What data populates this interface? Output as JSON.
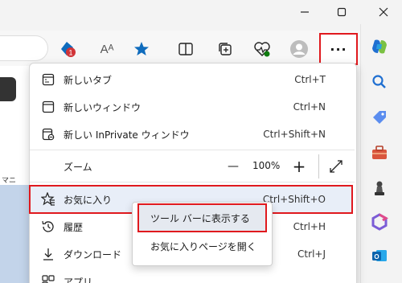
{
  "window": {
    "minimize_icon": "minimize-icon",
    "maximize_icon": "maximize-icon",
    "close_icon": "close-icon"
  },
  "toolbar": {
    "icons": [
      "extension-badge-icon",
      "read-aloud-icon",
      "favorite-star-icon",
      "split-screen-icon",
      "collections-icon",
      "browser-essentials-icon",
      "profile-avatar-icon"
    ],
    "badge_count": "1",
    "read_aloud_glyph": "Aᴬ",
    "more_label": "···"
  },
  "page_bg": {
    "fragment": "マニ"
  },
  "menu": {
    "items": [
      {
        "label": "新しいタブ",
        "shortcut": "Ctrl+T",
        "icon": "new-tab-icon"
      },
      {
        "label": "新しいウィンドウ",
        "shortcut": "Ctrl+N",
        "icon": "new-window-icon"
      },
      {
        "label": "新しい InPrivate ウィンドウ",
        "shortcut": "Ctrl+Shift+N",
        "icon": "inprivate-icon"
      }
    ],
    "zoom": {
      "label": "ズーム",
      "value": "100%",
      "minus": "—",
      "plus": "+"
    },
    "favorites": {
      "label": "お気に入り",
      "shortcut": "Ctrl+Shift+O",
      "icon": "favorites-icon"
    },
    "history": {
      "label": "履歴",
      "shortcut": "Ctrl+H",
      "icon": "history-icon"
    },
    "downloads": {
      "label": "ダウンロード",
      "shortcut": "Ctrl+J",
      "icon": "download-icon"
    },
    "apps": {
      "label": "アプリ",
      "icon": "apps-icon"
    }
  },
  "submenu": {
    "items": [
      "ツール バーに表示する",
      "お気に入りページを開く"
    ]
  },
  "sidebar": {
    "icons": [
      "copilot-icon",
      "search-icon",
      "shopping-tag-icon",
      "tools-icon",
      "games-icon",
      "microsoft365-icon",
      "outlook-icon"
    ]
  },
  "colors": {
    "highlight_border": "#e0191e",
    "accent_blue": "#0f6cbd"
  }
}
